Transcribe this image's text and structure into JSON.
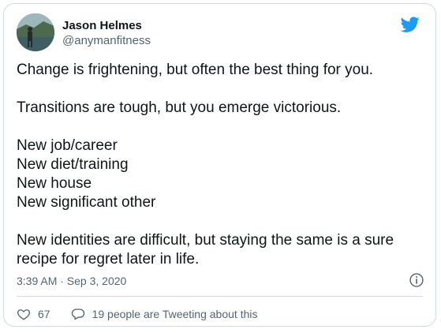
{
  "colors": {
    "text": "#0f1419",
    "secondary": "#536471",
    "twitter_blue": "#1d9bf0",
    "border": "#cfd9de"
  },
  "author": {
    "name": "Jason Helmes",
    "handle": "@anymanfitness",
    "avatar_icon": "profile-photo"
  },
  "brand_icon": "twitter-bird-icon",
  "tweet": {
    "paragraphs": [
      [
        "Change is frightening, but often the best thing for you."
      ],
      [
        "Transitions are tough, but you emerge victorious."
      ],
      [
        "New job/career",
        "New diet/training",
        "New house",
        "New significant other"
      ],
      [
        "New identities are difficult, but staying the same is a sure",
        "recipe for regret later in life."
      ]
    ]
  },
  "timestamp": "3:39 AM · Sep 3, 2020",
  "actions": {
    "likes_count": "67",
    "reply_text": "19 people are Tweeting about this"
  }
}
